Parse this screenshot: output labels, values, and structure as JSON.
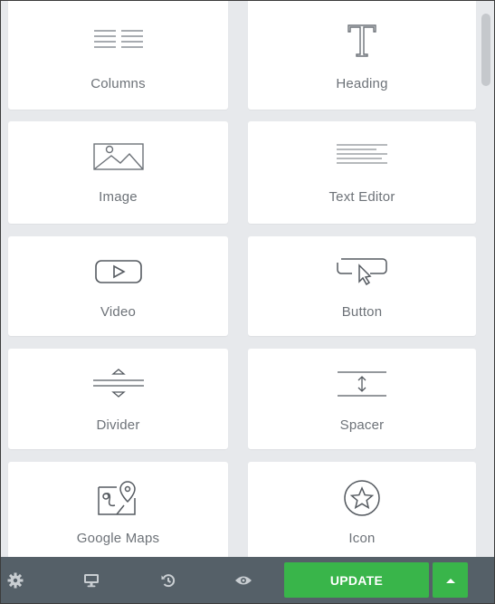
{
  "widgets": [
    {
      "label": "Columns",
      "icon": "columns-icon"
    },
    {
      "label": "Heading",
      "icon": "heading-icon"
    },
    {
      "label": "Image",
      "icon": "image-icon"
    },
    {
      "label": "Text Editor",
      "icon": "text-editor-icon"
    },
    {
      "label": "Video",
      "icon": "video-icon"
    },
    {
      "label": "Button",
      "icon": "button-icon"
    },
    {
      "label": "Divider",
      "icon": "divider-icon"
    },
    {
      "label": "Spacer",
      "icon": "spacer-icon"
    },
    {
      "label": "Google Maps",
      "icon": "google-maps-icon"
    },
    {
      "label": "Icon",
      "icon": "star-icon"
    }
  ],
  "footer": {
    "update_label": "UPDATE",
    "icons": [
      "settings-icon",
      "responsive-mode-icon",
      "history-icon",
      "preview-icon",
      "caret-up-icon"
    ]
  },
  "colors": {
    "panel_bg": "#e7e9ec",
    "card_bg": "#ffffff",
    "footer_bg": "#556068",
    "accent_green": "#39b54a",
    "label_gray": "#6d7278",
    "icon_gray": "#6d7278"
  }
}
